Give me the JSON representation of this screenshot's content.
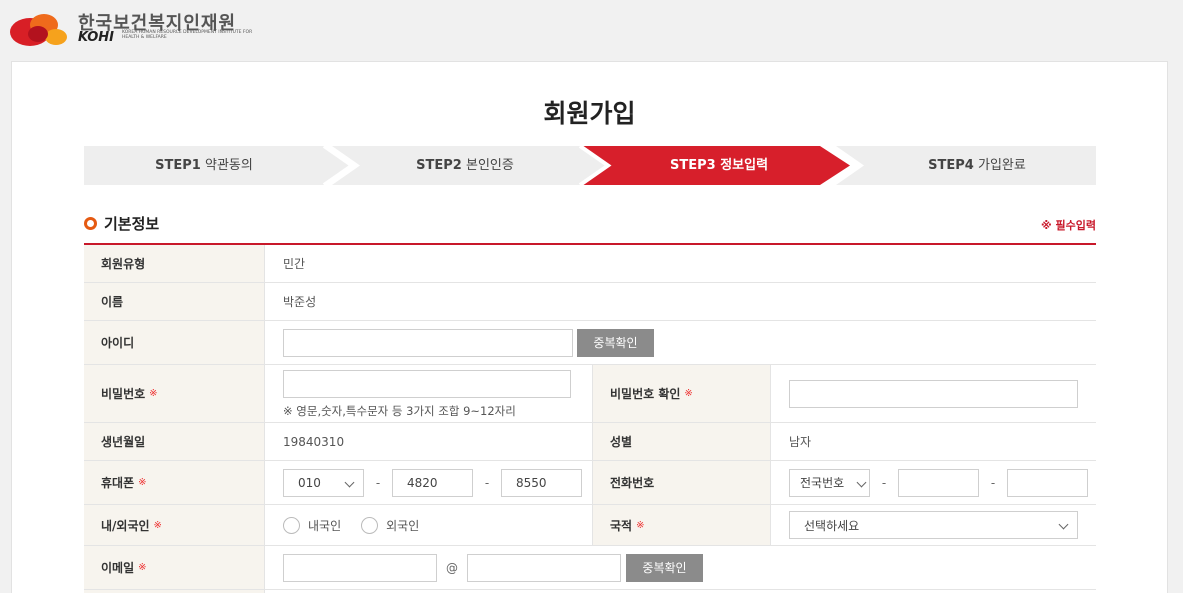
{
  "header": {
    "logo_korean": "한국보건복지인재원",
    "logo_english": "KOHI",
    "logo_sub": "KOREA HUMAN RESOURCE DEVELOPMENT INSTITUTE FOR HEALTH & WELFARE"
  },
  "page": {
    "title": "회원가입"
  },
  "steps": [
    {
      "num": "STEP1",
      "label": "약관동의",
      "active": false
    },
    {
      "num": "STEP2",
      "label": "본인인증",
      "active": false
    },
    {
      "num": "STEP3",
      "label": "정보입력",
      "active": true
    },
    {
      "num": "STEP4",
      "label": "가입완료",
      "active": false
    }
  ],
  "colors": {
    "accent_red": "#c8182a",
    "step_active": "#d71f2b",
    "step_inactive": "#eeeeee",
    "section_icon": "#e55a12"
  },
  "section": {
    "title": "기본정보",
    "required_note": "※ 필수입력"
  },
  "form": {
    "req_mark": "※",
    "member_type": {
      "label": "회원유형",
      "value": "민간"
    },
    "name": {
      "label": "이름",
      "value": "박준성"
    },
    "userid": {
      "label": "아이디",
      "value": "",
      "button": "중복확인"
    },
    "password": {
      "label": "비밀번호",
      "value": "",
      "hint": "※ 영문,숫자,특수문자 등 3가지 조합 9~12자리"
    },
    "password_confirm": {
      "label": "비밀번호 확인",
      "value": ""
    },
    "birth": {
      "label": "생년월일",
      "value": "19840310"
    },
    "gender": {
      "label": "성별",
      "value": "남자"
    },
    "mobile": {
      "label": "휴대폰",
      "prefix": "010",
      "mid": "4820",
      "last": "8550",
      "dash": "-"
    },
    "phone": {
      "label": "전화번호",
      "prefix": "전국번호",
      "mid": "",
      "last": "",
      "dash": "-"
    },
    "nationality_type": {
      "label": "내/외국인",
      "opt1": "내국인",
      "opt2": "외국인"
    },
    "nationality": {
      "label": "국적",
      "value": "선택하세요"
    },
    "email": {
      "label": "이메일",
      "local": "",
      "at": "@",
      "domain": "",
      "button": "중복확인"
    }
  }
}
